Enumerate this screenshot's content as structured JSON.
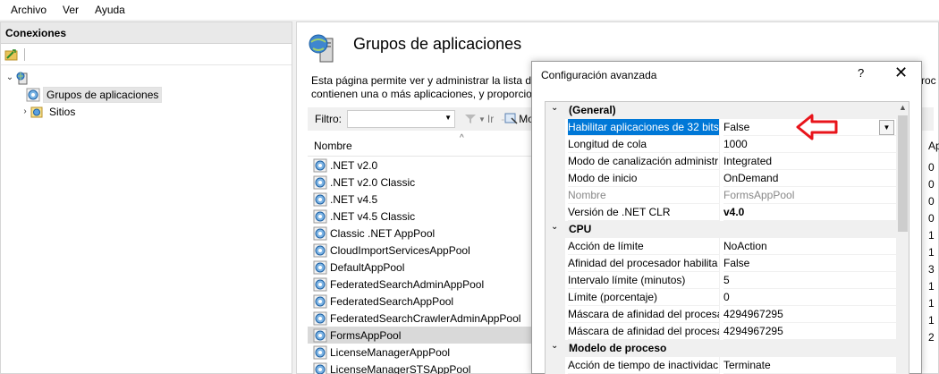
{
  "menubar": {
    "items": [
      "Archivo",
      "Ver",
      "Ayuda"
    ]
  },
  "left": {
    "header": "Conexiones",
    "tree": [
      {
        "label": ""
      },
      {
        "label": "Grupos de aplicaciones"
      },
      {
        "label": "Sitios"
      }
    ]
  },
  "main": {
    "title": "Grupos de aplicaciones",
    "desc_line1": "Esta página permite ver y administrar la lista de",
    "desc_line2": "contienen una o más aplicaciones, y proporcior",
    "desc_right1": "roc",
    "filter_label": "Filtro:",
    "go_label": "Ir",
    "show_label": "Mo",
    "column_name": "Nombre",
    "right_col_header": "Ap",
    "pools": [
      ".NET v2.0",
      ".NET v2.0 Classic",
      ".NET v4.5",
      ".NET v4.5 Classic",
      "Classic .NET AppPool",
      "CloudImportServicesAppPool",
      "DefaultAppPool",
      "FederatedSearchAdminAppPool",
      "FederatedSearchAppPool",
      "FederatedSearchCrawlerAdminAppPool",
      "FormsAppPool",
      "LicenseManagerAppPool",
      "LicenseManagerSTSAppPool"
    ],
    "right_values": [
      "0",
      "0",
      "0",
      "0",
      "1",
      "1",
      "3",
      "1",
      "1",
      "1",
      "2",
      "",
      ""
    ]
  },
  "dialog": {
    "title": "Configuración avanzada",
    "help": "?",
    "close": "✕",
    "categories": {
      "general": "(General)",
      "cpu": "CPU",
      "process": "Modelo de proceso"
    },
    "rows": {
      "r32": {
        "name": "Habilitar aplicaciones de 32 bits",
        "value": "False"
      },
      "queue": {
        "name": "Longitud de cola",
        "value": "1000"
      },
      "pipeline": {
        "name": "Modo de canalización administr",
        "value": "Integrated"
      },
      "start": {
        "name": "Modo de inicio",
        "value": "OnDemand"
      },
      "nombre": {
        "name": "Nombre",
        "value": "FormsAppPool"
      },
      "clr": {
        "name": "Versión de .NET CLR",
        "value": "v4.0"
      },
      "limit_action": {
        "name": "Acción de límite",
        "value": "NoAction"
      },
      "affinity": {
        "name": "Afinidad del procesador habilita",
        "value": "False"
      },
      "interval": {
        "name": "Intervalo límite (minutos)",
        "value": "5"
      },
      "limit": {
        "name": "Límite (porcentaje)",
        "value": "0"
      },
      "mask1": {
        "name": "Máscara de afinidad del procesa",
        "value": "4294967295"
      },
      "mask2": {
        "name": "Máscara de afinidad del procesa",
        "value": "4294967295"
      },
      "idle": {
        "name": "Acción de tiempo de inactividac",
        "value": "Terminate"
      }
    }
  },
  "colors": {
    "selection": "#0078d7",
    "arrow": "#e8141b"
  }
}
